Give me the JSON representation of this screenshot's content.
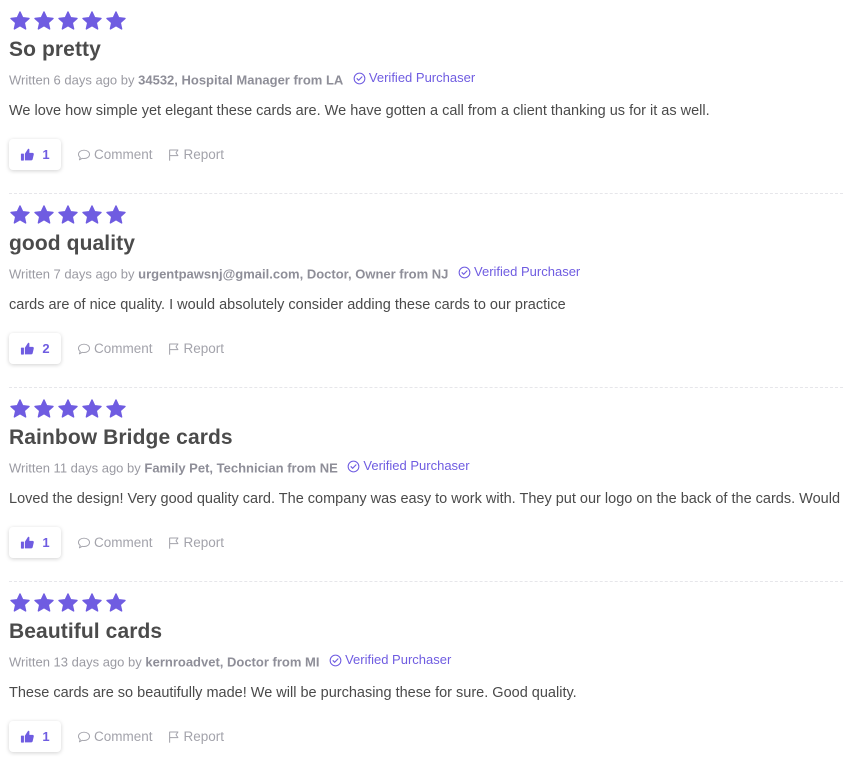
{
  "colors": {
    "accent": "#6f5ce1",
    "star": "#6f5ce1",
    "muted": "#9a9aa2",
    "text": "#4a4a4a"
  },
  "icons": {
    "star": "star-icon",
    "verified": "check-circle-icon",
    "like": "thumbs-up-icon",
    "comment": "speech-bubble-icon",
    "report": "flag-icon"
  },
  "reviews": [
    {
      "rating": 5,
      "title": "So pretty",
      "written": "Written 6 days ago by",
      "author": "34532, Hospital Manager from LA",
      "verified": "Verified Purchaser",
      "body": "We love how simple yet elegant these cards are. We have gotten a call from a client thanking us for it as well.",
      "likes": "1",
      "comment_label": "Comment",
      "report_label": "Report"
    },
    {
      "rating": 5,
      "title": "good quality",
      "written": "Written 7 days ago by",
      "author": "urgentpawsnj@gmail.com, Doctor, Owner from NJ",
      "verified": "Verified Purchaser",
      "body": "cards are of nice quality. I would absolutely consider adding these cards to our practice",
      "likes": "2",
      "comment_label": "Comment",
      "report_label": "Report"
    },
    {
      "rating": 5,
      "title": "Rainbow Bridge cards",
      "written": "Written 11 days ago by",
      "author": "Family Pet, Technician from NE",
      "verified": "Verified Purchaser",
      "body": "Loved the design! Very good quality card. The company was easy to work with. They put our logo on the back of the cards. Would",
      "likes": "1",
      "comment_label": "Comment",
      "report_label": "Report"
    },
    {
      "rating": 5,
      "title": "Beautiful cards",
      "written": "Written 13 days ago by",
      "author": "kernroadvet, Doctor from MI",
      "verified": "Verified Purchaser",
      "body": "These cards are so beautifully made! We will be purchasing these for sure. Good quality.",
      "likes": "1",
      "comment_label": "Comment",
      "report_label": "Report"
    }
  ]
}
